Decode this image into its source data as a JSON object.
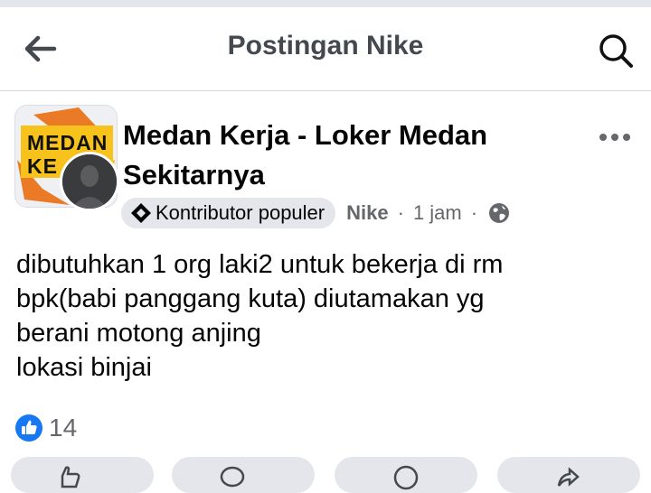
{
  "header": {
    "title": "Postingan Nike",
    "back_icon": "arrow-left-icon",
    "search_icon": "search-icon"
  },
  "post": {
    "group_name": "Medan Kerja - Loker Medan Sekitarnya",
    "group_logo_text": "MEDAN\nKE",
    "badge_label": "Kontributor populer",
    "author": "Nike",
    "separator": "·",
    "time": "1 jam",
    "privacy_icon": "globe-icon",
    "body_lines": [
      "dibutuhkan 1 org laki2 untuk bekerja di rm",
      "bpk(babi panggang kuta) diutamakan yg",
      "berani motong anjing",
      "lokasi binjai"
    ],
    "reaction_count": "14",
    "reaction_icon": "like-icon"
  },
  "colors": {
    "accent": "#1877f2",
    "secondary_text": "#65676b",
    "header_text": "#444950",
    "chip_bg": "#e4e6eb",
    "logo_yellow": "#f6c21b",
    "logo_orange": "#ea7a25"
  }
}
